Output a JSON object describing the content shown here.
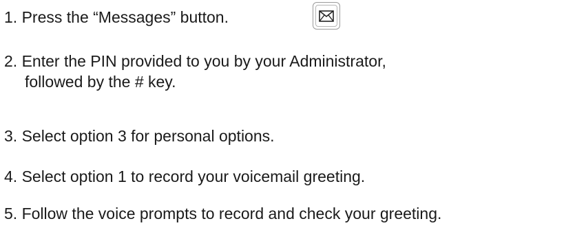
{
  "steps": [
    {
      "num": "1.",
      "text": "Press the “Messages” button."
    },
    {
      "num": "2.",
      "text": "Enter the PIN provided to you by your Administrator,",
      "continuation": "followed by the # key."
    },
    {
      "num": "3.",
      "text": "Select option 3 for personal options."
    },
    {
      "num": "4.",
      "text": " Select option 1 to record your voicemail greeting."
    },
    {
      "num": "5.",
      "text": "Follow the voice prompts to record and check your greeting."
    }
  ],
  "icons": {
    "messages_button": "envelope-icon"
  }
}
